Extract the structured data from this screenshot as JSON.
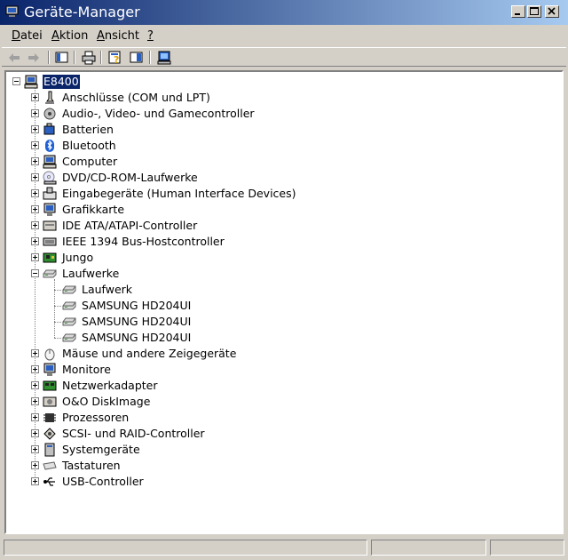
{
  "window": {
    "title": "Geräte-Manager",
    "icon": "device-manager-icon",
    "titlebar_colors": [
      "#0a246a",
      "#a6caf0"
    ]
  },
  "menu": {
    "items": [
      {
        "label": "Datei",
        "icon": null
      },
      {
        "label": "Aktion",
        "icon": null
      },
      {
        "label": "Ansicht",
        "icon": null
      },
      {
        "label": "?",
        "icon": null
      }
    ]
  },
  "toolbar": {
    "buttons": [
      "back-arrow-icon",
      "forward-arrow-icon",
      "show-hide-console-tree-icon",
      "print-icon",
      "help-properties-icon",
      "show-hide-action-pane-icon",
      "scan-hardware-icon"
    ]
  },
  "tree": {
    "root": {
      "label": "E8400",
      "icon": "computer-icon",
      "expanded": true,
      "selected": true
    },
    "categories": [
      {
        "label": "Anschlüsse (COM und LPT)",
        "icon": "port-icon",
        "expanded": false
      },
      {
        "label": "Audio-, Video- und Gamecontroller",
        "icon": "audio-icon",
        "expanded": false
      },
      {
        "label": "Batterien",
        "icon": "battery-icon",
        "expanded": false
      },
      {
        "label": "Bluetooth",
        "icon": "bluetooth-icon",
        "expanded": false
      },
      {
        "label": "Computer",
        "icon": "computer-icon",
        "expanded": false
      },
      {
        "label": "DVD/CD-ROM-Laufwerke",
        "icon": "cd-drive-icon",
        "expanded": false
      },
      {
        "label": "Eingabegeräte (Human Interface Devices)",
        "icon": "hid-icon",
        "expanded": false
      },
      {
        "label": "Grafikkarte",
        "icon": "display-adapter-icon",
        "expanded": false
      },
      {
        "label": "IDE ATA/ATAPI-Controller",
        "icon": "ide-controller-icon",
        "expanded": false
      },
      {
        "label": "IEEE 1394 Bus-Hostcontroller",
        "icon": "firewire-icon",
        "expanded": false
      },
      {
        "label": "Jungo",
        "icon": "board-icon",
        "expanded": false
      },
      {
        "label": "Laufwerke",
        "icon": "disk-drive-icon",
        "expanded": true,
        "children": [
          {
            "label": "Laufwerk",
            "icon": "disk-drive-icon"
          },
          {
            "label": "SAMSUNG HD204UI",
            "icon": "disk-drive-icon"
          },
          {
            "label": "SAMSUNG HD204UI",
            "icon": "disk-drive-icon"
          },
          {
            "label": "SAMSUNG HD204UI",
            "icon": "disk-drive-icon"
          }
        ]
      },
      {
        "label": "Mäuse und andere Zeigegeräte",
        "icon": "mouse-icon",
        "expanded": false
      },
      {
        "label": "Monitore",
        "icon": "monitor-icon",
        "expanded": false
      },
      {
        "label": "Netzwerkadapter",
        "icon": "network-adapter-icon",
        "expanded": false
      },
      {
        "label": "O&O DiskImage",
        "icon": "disk-image-icon",
        "expanded": false
      },
      {
        "label": "Prozessoren",
        "icon": "processor-icon",
        "expanded": false
      },
      {
        "label": "SCSI- und RAID-Controller",
        "icon": "scsi-icon",
        "expanded": false
      },
      {
        "label": "Systemgeräte",
        "icon": "system-device-icon",
        "expanded": false
      },
      {
        "label": "Tastaturen",
        "icon": "keyboard-icon",
        "expanded": false
      },
      {
        "label": "USB-Controller",
        "icon": "usb-icon",
        "expanded": false
      }
    ]
  },
  "statusbar": {
    "panels": [
      "",
      "",
      ""
    ]
  },
  "colors": {
    "chrome": "#d4d0c8",
    "selection": "#0a246a",
    "tree_background": "#ffffff"
  }
}
